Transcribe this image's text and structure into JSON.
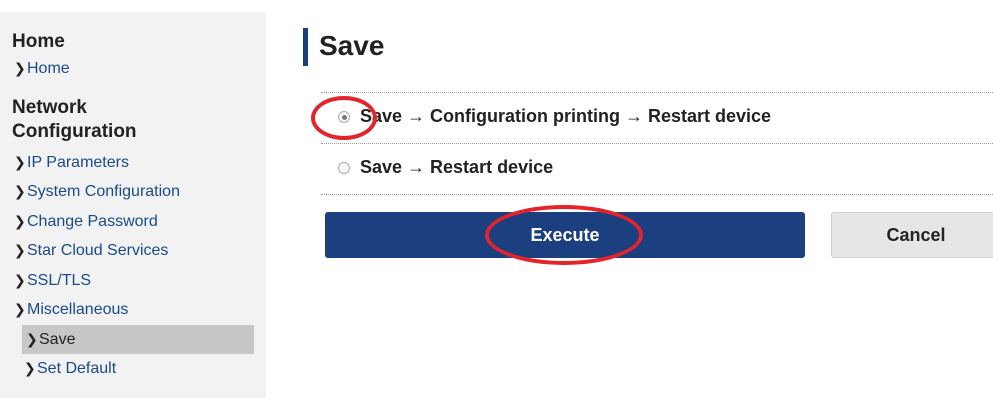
{
  "sidebar": {
    "home_heading": "Home",
    "home_items": [
      {
        "label": "Home",
        "chevron": "chevron-right-icon"
      }
    ],
    "network_heading": "Network Configuration",
    "network_items": [
      {
        "label": "IP Parameters"
      },
      {
        "label": "System Configuration"
      },
      {
        "label": "Change Password"
      },
      {
        "label": "Star Cloud Services"
      },
      {
        "label": "SSL/TLS"
      },
      {
        "label": "Miscellaneous"
      },
      {
        "label": "Save",
        "active": true
      },
      {
        "label": "Set Default"
      }
    ]
  },
  "main": {
    "title": "Save",
    "options": [
      {
        "label": "Save → Configuration printing → Restart device",
        "selected": true
      },
      {
        "label": "Save → Restart device",
        "selected": false
      }
    ],
    "execute_label": "Execute",
    "cancel_label": "Cancel"
  },
  "colors": {
    "accent": "#1c3f80",
    "annotation": "#e3242b",
    "sidebar_bg": "#f2f2f2",
    "active_item_bg": "#c7c7c7"
  }
}
